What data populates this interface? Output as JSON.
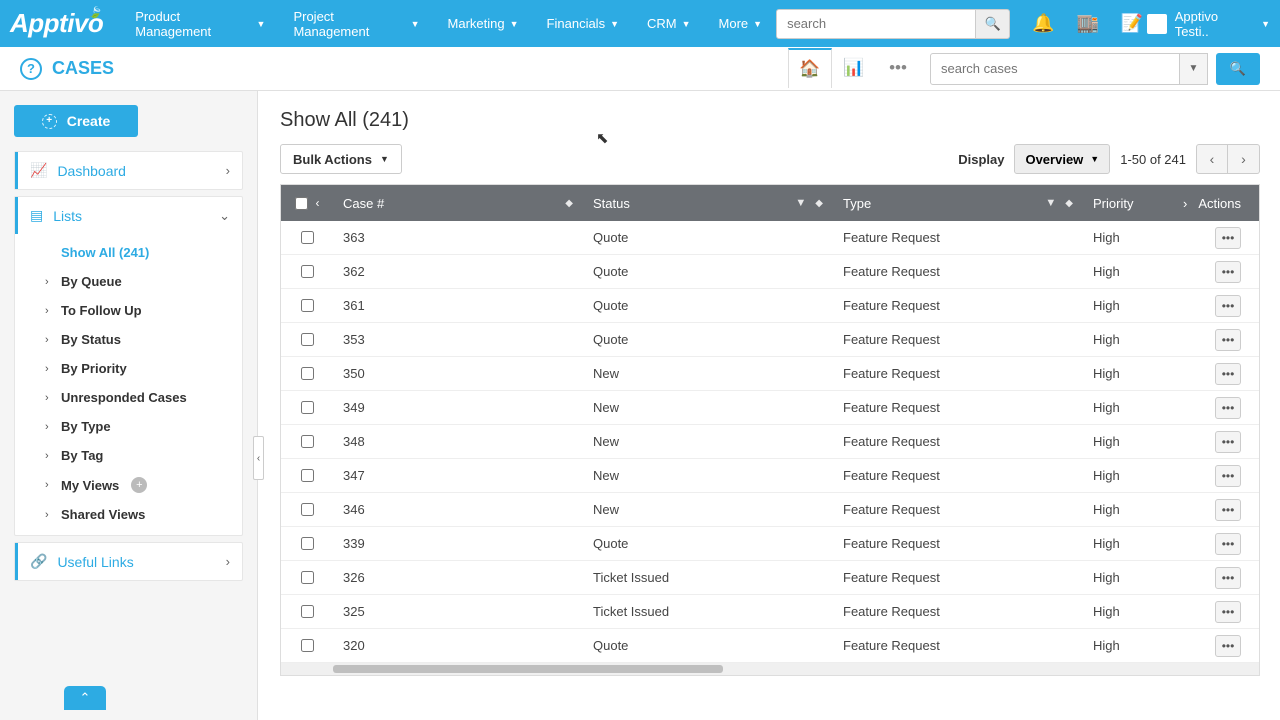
{
  "brand": "Apptivo",
  "topnav": {
    "items": [
      "Product Management",
      "Project Management",
      "Marketing",
      "Financials",
      "CRM",
      "More"
    ],
    "search_placeholder": "search",
    "user_name": "Apptivo Testi.."
  },
  "module": {
    "title": "CASES",
    "search_placeholder": "search cases"
  },
  "sidebar": {
    "create_label": "Create",
    "dashboard_label": "Dashboard",
    "lists_label": "Lists",
    "useful_links_label": "Useful Links",
    "lists": {
      "show_all": "Show All (241)",
      "items": [
        "By Queue",
        "To Follow Up",
        "By Status",
        "By Priority",
        "Unresponded Cases",
        "By Type",
        "By Tag",
        "My Views",
        "Shared Views"
      ]
    }
  },
  "main": {
    "page_title": "Show All (241)",
    "bulk_actions_label": "Bulk Actions",
    "display_label": "Display",
    "overview_label": "Overview",
    "range_text": "1-50 of 241"
  },
  "table": {
    "headers": {
      "case": "Case #",
      "status": "Status",
      "type": "Type",
      "priority": "Priority",
      "actions": "Actions"
    },
    "rows": [
      {
        "case": "363",
        "status": "Quote",
        "type": "Feature Request",
        "priority": "High"
      },
      {
        "case": "362",
        "status": "Quote",
        "type": "Feature Request",
        "priority": "High"
      },
      {
        "case": "361",
        "status": "Quote",
        "type": "Feature Request",
        "priority": "High"
      },
      {
        "case": "353",
        "status": "Quote",
        "type": "Feature Request",
        "priority": "High"
      },
      {
        "case": "350",
        "status": "New",
        "type": "Feature Request",
        "priority": "High"
      },
      {
        "case": "349",
        "status": "New",
        "type": "Feature Request",
        "priority": "High"
      },
      {
        "case": "348",
        "status": "New",
        "type": "Feature Request",
        "priority": "High"
      },
      {
        "case": "347",
        "status": "New",
        "type": "Feature Request",
        "priority": "High"
      },
      {
        "case": "346",
        "status": "New",
        "type": "Feature Request",
        "priority": "High"
      },
      {
        "case": "339",
        "status": "Quote",
        "type": "Feature Request",
        "priority": "High"
      },
      {
        "case": "326",
        "status": "Ticket Issued",
        "type": "Feature Request",
        "priority": "High"
      },
      {
        "case": "325",
        "status": "Ticket Issued",
        "type": "Feature Request",
        "priority": "High"
      },
      {
        "case": "320",
        "status": "Quote",
        "type": "Feature Request",
        "priority": "High"
      }
    ]
  }
}
